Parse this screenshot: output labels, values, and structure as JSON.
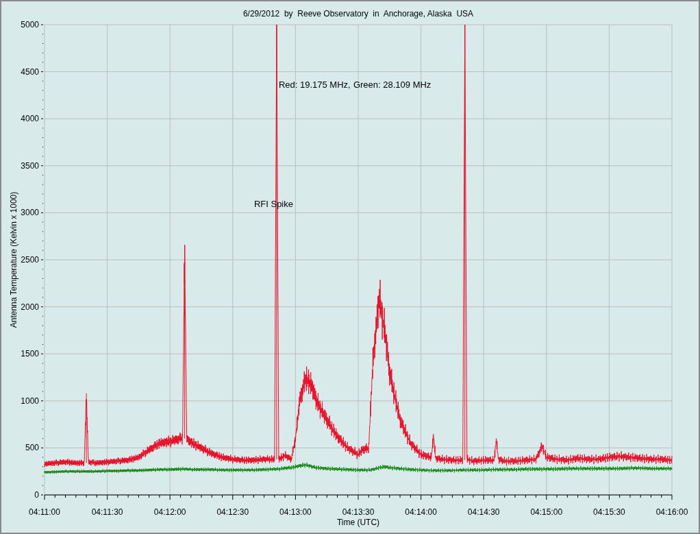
{
  "plot": {
    "title": "6/29/2012  by  Reeve Observatory  in  Anchorage, Alaska  USA",
    "y_axis_label": "Antenna Temperature (Kelvin x 1000)",
    "x_axis_label": "Time (UTC)",
    "y_ticks": [
      "5000",
      "4500",
      "4000",
      "3500",
      "3000",
      "2500",
      "2000",
      "1500",
      "1000",
      "500",
      "0"
    ],
    "x_ticks": [
      "04:11:00",
      "04:11:30",
      "04:12:00",
      "04:12:30",
      "04:13:00",
      "04:13:30",
      "04:14:00",
      "04:14:30",
      "04:15:00",
      "04:15:30",
      "04:16:00"
    ],
    "traces": [
      {
        "label": "Red: 19.175 MHz,",
        "color": "#e8102a"
      },
      {
        "label": "Green: 28.109 MHz",
        "color": "#178a17"
      }
    ],
    "annotation": "RFI Spike"
  }
}
